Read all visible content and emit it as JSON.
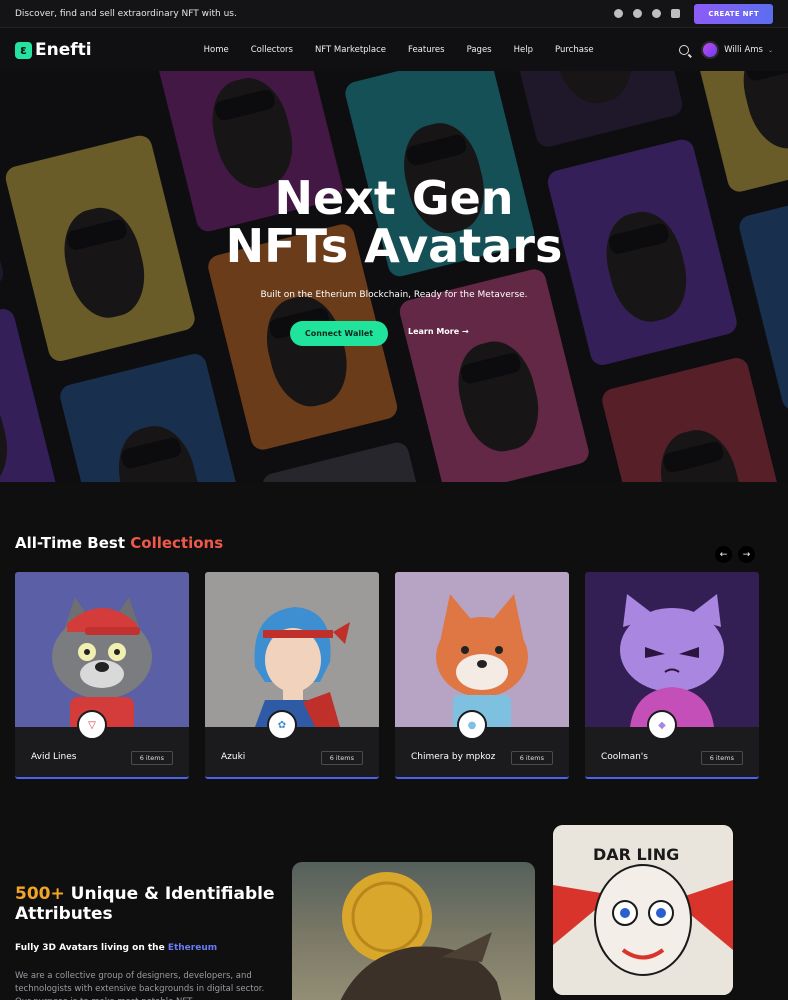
{
  "topbar": {
    "message": "Discover, find and sell extraordinary NFT with us.",
    "socials": [
      "telegram-icon",
      "facebook-icon",
      "twitter-icon",
      "linkedin-icon"
    ],
    "create_button": "CREATE NFT"
  },
  "nav": {
    "logo_mark": "ε",
    "logo_text": "Enefti",
    "items": [
      "Home",
      "Collectors",
      "NFT Marketplace",
      "Features",
      "Pages",
      "Help",
      "Purchase"
    ],
    "user_name": "Willi Ams"
  },
  "hero": {
    "title_line1": "Next Gen",
    "title_line2": "NFTs Avatars",
    "subtitle": "Built on the Etherium Blockchain, Ready for the Metaverse.",
    "connect_button": "Connect Wallet",
    "learn_more": "Learn More →"
  },
  "collections": {
    "title_prefix": "All-Time Best",
    "title_accent": "Collections",
    "prev_arrow": "←",
    "next_arrow": "→",
    "items": [
      {
        "name": "Avid Lines",
        "count": "6 items",
        "bg": "#5b5fa6"
      },
      {
        "name": "Azuki",
        "count": "6 items",
        "bg": "#9c9b99"
      },
      {
        "name": "Chimera by mpkoz",
        "count": "6 items",
        "bg": "#b7a3c4"
      },
      {
        "name": "Coolman's",
        "count": "6 items",
        "bg": "#341f55"
      }
    ]
  },
  "attributes": {
    "title_accent": "500+",
    "title_rest": "Unique & Identifiable Attributes",
    "subtitle_prefix": "Fully 3D Avatars living on the",
    "subtitle_accent": "Ethereum",
    "body": "We are a collective group of designers, developers, and technologists with extensive backgrounds in digital sector. Our purpose is to make most notable NFT"
  },
  "colors": {
    "accent_green": "#20e39c",
    "accent_red": "#f0584a",
    "accent_orange": "#f2a623",
    "accent_blue": "#6a7cf5",
    "create_gradient_start": "#8d5cf6"
  }
}
